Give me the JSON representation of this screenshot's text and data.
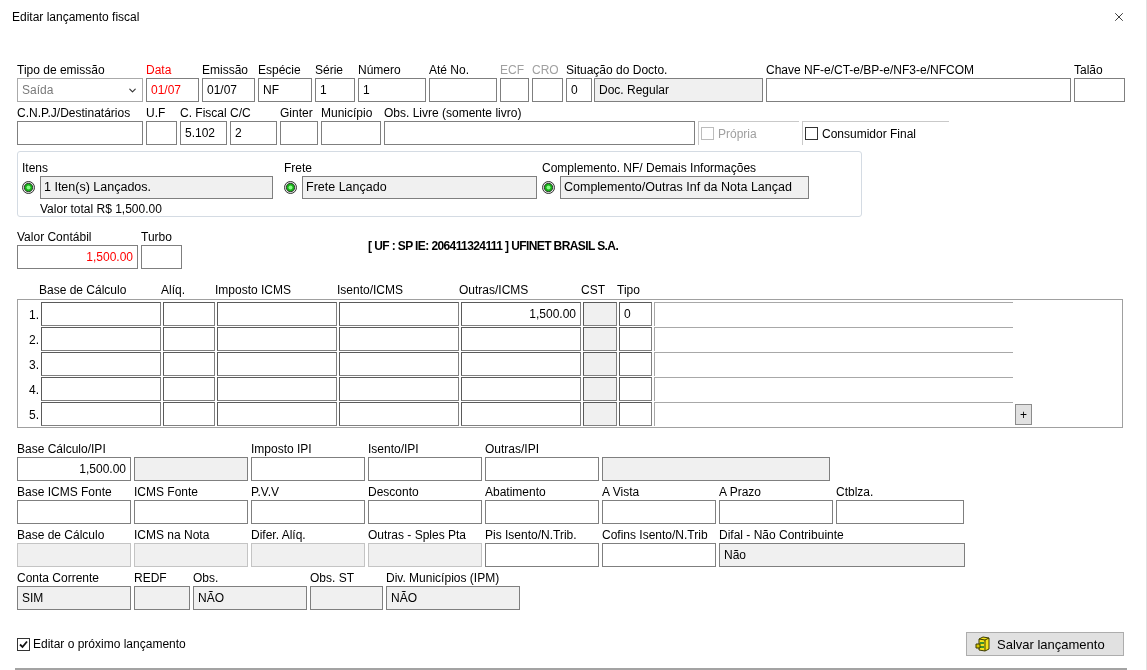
{
  "window": {
    "title": "Editar lançamento fiscal"
  },
  "document_row": [
    {
      "label": "Tipo de emissão",
      "required": false,
      "disabled": false,
      "inputs": [
        {
          "kind": "select",
          "value": "Saída"
        }
      ]
    },
    {
      "label": "Data",
      "required": true,
      "disabled": false,
      "inputs": [
        {
          "kind": "text",
          "value": "01/07",
          "alert": true
        }
      ]
    },
    {
      "label": "Emissão",
      "required": false,
      "disabled": false,
      "inputs": [
        {
          "kind": "text",
          "value": "01/07"
        }
      ]
    },
    {
      "label": "Espécie",
      "required": false,
      "disabled": false,
      "inputs": [
        {
          "kind": "text",
          "value": "NF"
        }
      ]
    },
    {
      "label": "Série",
      "required": false,
      "disabled": false,
      "inputs": [
        {
          "kind": "text",
          "value": "1"
        }
      ]
    },
    {
      "label": "Número",
      "required": false,
      "disabled": false,
      "inputs": [
        {
          "kind": "text",
          "value": "1"
        }
      ]
    },
    {
      "label": "Até No.",
      "required": false,
      "disabled": false,
      "inputs": [
        {
          "kind": "text"
        }
      ]
    },
    {
      "label": "ECF",
      "required": false,
      "disabled": true,
      "inputs": [
        {
          "kind": "text"
        }
      ]
    },
    {
      "label": "CRO",
      "required": false,
      "disabled": true,
      "inputs": [
        {
          "kind": "text"
        }
      ]
    },
    {
      "label": "Situação do Docto.",
      "required": false,
      "disabled": false,
      "inputs": [
        {
          "kind": "text",
          "value": "0"
        },
        {
          "kind": "readonly",
          "value": "Doc. Regular"
        }
      ]
    },
    {
      "label": "Chave NF-e/CT-e/BP-e/NF3-e/NFCOM",
      "required": false,
      "disabled": false,
      "inputs": [
        {
          "kind": "text"
        }
      ]
    },
    {
      "label": "Talão",
      "required": false,
      "disabled": false,
      "inputs": [
        {
          "kind": "text"
        }
      ]
    }
  ],
  "recipient_row": {
    "fields": [
      {
        "label": "C.N.P.J/Destinatários",
        "inputs": [
          {
            "kind": "text"
          }
        ]
      },
      {
        "label": "U.F",
        "inputs": [
          {
            "kind": "text"
          }
        ]
      },
      {
        "label": "C. Fiscal",
        "inputs": [
          {
            "kind": "text",
            "value": "5.102"
          }
        ]
      },
      {
        "label": "C/C",
        "inputs": [
          {
            "kind": "text",
            "value": "2"
          }
        ]
      },
      {
        "label": "Ginter",
        "inputs": [
          {
            "kind": "text"
          }
        ]
      },
      {
        "label": "Município",
        "inputs": [
          {
            "kind": "text"
          }
        ]
      },
      {
        "label": "Obs. Livre (somente livro)",
        "inputs": [
          {
            "kind": "text"
          }
        ]
      }
    ],
    "checkboxes": [
      {
        "label": "Própria",
        "checked": false,
        "disabled": true
      },
      {
        "label": "Consumidor Final",
        "checked": false,
        "disabled": false
      }
    ]
  },
  "status_panel": {
    "items": [
      {
        "label": "Itens",
        "lit": true,
        "value": "1 Iten(s) Lançados."
      },
      {
        "label": "Frete",
        "lit": true,
        "value": "Frete Lançado"
      },
      {
        "label": "Complemento. NF/ Demais Informações",
        "lit": true,
        "value": "Complemento/Outras Inf da Nota Lançad"
      }
    ],
    "total": "Valor total R$ 1,500.00"
  },
  "value_row": {
    "fields": [
      {
        "label": "Valor Contábil",
        "inputs": [
          {
            "kind": "amount",
            "value": "1,500.00",
            "alert": true
          }
        ]
      },
      {
        "label": "Turbo",
        "inputs": [
          {
            "kind": "text"
          }
        ]
      }
    ],
    "company": "[ UF : SP IE: 206411324111 ] UFINET BRASIL S.A."
  },
  "icms_table": {
    "columns": [
      {
        "label": "Base de Cálculo",
        "kind": "amount"
      },
      {
        "label": "Alíq.",
        "kind": "amount"
      },
      {
        "label": "Imposto ICMS",
        "kind": "amount"
      },
      {
        "label": "Isento/ICMS",
        "kind": "amount"
      },
      {
        "label": "Outras/ICMS",
        "kind": "amount"
      },
      {
        "label": "CST",
        "kind": "readonly"
      },
      {
        "label": "Tipo",
        "kind": "text"
      }
    ],
    "rows": [
      {
        "number": "1.",
        "cells": [
          {},
          {},
          {},
          {},
          {
            "value": "1,500.00"
          },
          {},
          {
            "value": "0"
          }
        ]
      },
      {
        "number": "2.",
        "cells": [
          {},
          {},
          {},
          {},
          {},
          {},
          {}
        ]
      },
      {
        "number": "3.",
        "cells": [
          {},
          {},
          {},
          {},
          {},
          {},
          {}
        ]
      },
      {
        "number": "4.",
        "cells": [
          {},
          {},
          {},
          {},
          {},
          {},
          {}
        ]
      },
      {
        "number": "5.",
        "cells": [
          {},
          {},
          {},
          {},
          {},
          {},
          {}
        ]
      }
    ],
    "add_button": "+"
  },
  "tax_rows": [
    [
      {
        "label": "Base Cálculo/IPI",
        "inputs": [
          {
            "kind": "amount",
            "value": "1,500.00"
          }
        ]
      },
      {
        "inputs": [
          {
            "kind": "readonly"
          }
        ]
      },
      {
        "label": "Imposto IPI",
        "inputs": [
          {
            "kind": "text"
          }
        ]
      },
      {
        "label": "Isento/IPI",
        "inputs": [
          {
            "kind": "text"
          }
        ]
      },
      {
        "label": "Outras/IPI",
        "inputs": [
          {
            "kind": "text"
          }
        ]
      },
      {
        "inputs": [
          {
            "kind": "readonly"
          }
        ]
      }
    ],
    [
      {
        "label": "Base ICMS Fonte",
        "inputs": [
          {
            "kind": "text"
          }
        ]
      },
      {
        "label": "ICMS Fonte",
        "inputs": [
          {
            "kind": "text"
          }
        ]
      },
      {
        "label": "P.V.V",
        "inputs": [
          {
            "kind": "text"
          }
        ]
      },
      {
        "label": "Desconto",
        "inputs": [
          {
            "kind": "text"
          }
        ]
      },
      {
        "label": "Abatimento",
        "inputs": [
          {
            "kind": "text"
          }
        ]
      },
      {
        "label": "A Vista",
        "inputs": [
          {
            "kind": "text"
          }
        ]
      },
      {
        "label": "A Prazo",
        "inputs": [
          {
            "kind": "text"
          }
        ]
      },
      {
        "label": "Ctblza.",
        "inputs": [
          {
            "kind": "text"
          }
        ]
      }
    ],
    [
      {
        "label": "Base de Cálculo",
        "inputs": [
          {
            "kind": "inactive"
          }
        ]
      },
      {
        "label": "ICMS na Nota",
        "inputs": [
          {
            "kind": "inactive"
          }
        ]
      },
      {
        "label": "Difer. Alíq.",
        "inputs": [
          {
            "kind": "inactive"
          }
        ]
      },
      {
        "label": "Outras - Sples Pta",
        "inputs": [
          {
            "kind": "inactive"
          }
        ]
      },
      {
        "label": "Pis Isento/N.Trib.",
        "inputs": [
          {
            "kind": "text"
          }
        ]
      },
      {
        "label": "Cofins Isento/N.Trib",
        "inputs": [
          {
            "kind": "text"
          }
        ]
      },
      {
        "label": "Difal - Não Contribuinte",
        "inputs": [
          {
            "kind": "readonly",
            "value": "Não"
          }
        ]
      }
    ],
    [
      {
        "label": "Conta Corrente",
        "inputs": [
          {
            "kind": "readonly",
            "value": "SIM"
          }
        ]
      },
      {
        "label": "REDF",
        "inputs": [
          {
            "kind": "readonly"
          }
        ]
      },
      {
        "label": "Obs.",
        "inputs": [
          {
            "kind": "readonly",
            "value": "NÃO"
          }
        ]
      },
      {
        "label": "Obs. ST",
        "inputs": [
          {
            "kind": "readonly"
          }
        ]
      },
      {
        "label": "Div. Municípios (IPM)",
        "inputs": [
          {
            "kind": "readonly",
            "value": "NÃO"
          }
        ]
      }
    ]
  ],
  "next_entry": {
    "label": "Editar o próximo lançamento",
    "checked": true
  },
  "save_button": {
    "label": "Salvar lançamento"
  }
}
